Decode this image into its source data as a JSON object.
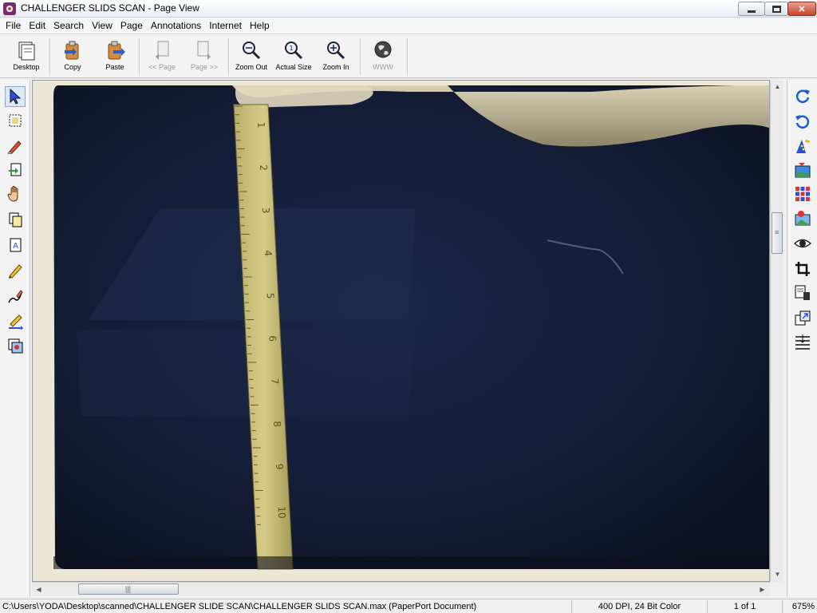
{
  "window": {
    "title": "CHALLENGER SLIDS SCAN - Page View",
    "icons": {
      "app": "paperport-app-icon",
      "minimize": "minimize-icon",
      "maximize": "maximize-icon",
      "close": "close-icon"
    }
  },
  "menu": [
    "File",
    "Edit",
    "Search",
    "View",
    "Page",
    "Annotations",
    "Internet",
    "Help"
  ],
  "toolbar": {
    "desktop": "Desktop",
    "copy": "Copy",
    "paste": "Paste",
    "prev_page": "<< Page",
    "next_page": "Page >>",
    "zoom_out": "Zoom Out",
    "actual_size": "Actual Size",
    "zoom_in": "Zoom In",
    "www": "WWW"
  },
  "left_tools": [
    "select-arrow-icon",
    "rectangle-select-icon",
    "eraser-icon",
    "insert-page-icon",
    "hand-pan-icon",
    "copy-page-icon",
    "annotation-note-icon",
    "pen-icon",
    "freehand-line-icon",
    "arrow-line-icon",
    "stamp-image-icon"
  ],
  "right_tools": [
    "rotate-clockwise-icon",
    "rotate-counterclockwise-icon",
    "wizard-enhance-icon",
    "photo-enhance-icon",
    "color-grid-icon",
    "red-eye-icon",
    "eye-icon",
    "crop-icon",
    "page-export-icon",
    "image-resize-icon",
    "deskew-lines-icon"
  ],
  "status": {
    "path": "C:\\Users\\YODA\\Desktop\\scanned\\CHALLENGER SLIDE SCAN\\CHALLENGER SLIDS SCAN.max (PaperPort Document)",
    "resolution": "400 DPI, 24 Bit Color",
    "page": "1 of 1",
    "zoom": "675%"
  },
  "scan": {
    "ruler_marks": [
      "1",
      "2",
      "3",
      "4",
      "5",
      "6",
      "7",
      "8",
      "9",
      "10"
    ]
  }
}
